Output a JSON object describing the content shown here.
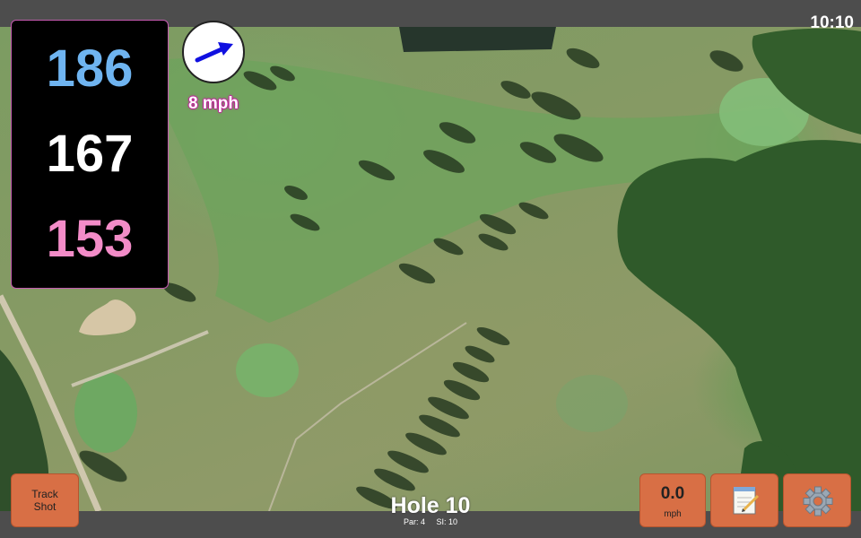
{
  "status_bar": {
    "time": "10:10"
  },
  "distances": {
    "back": "186",
    "middle": "167",
    "front": "153"
  },
  "wind": {
    "speed": "8 mph",
    "icon": "wind-arrow-icon",
    "arrow_color": "#1010e0"
  },
  "buttons": {
    "track_shot_line1": "Track",
    "track_shot_line2": "Shot",
    "speed_value": "0.0",
    "speed_unit": "mph",
    "notes_icon": "notepad-icon",
    "settings_icon": "gear-icon"
  },
  "hole": {
    "title": "Hole 10",
    "par": "Par: 4",
    "stroke_index": "SI: 10"
  },
  "colors": {
    "back": "#6fb4f0",
    "middle": "#ffffff",
    "front": "#f38cc8",
    "button": "#d86f45",
    "accent": "#c45ab0"
  }
}
